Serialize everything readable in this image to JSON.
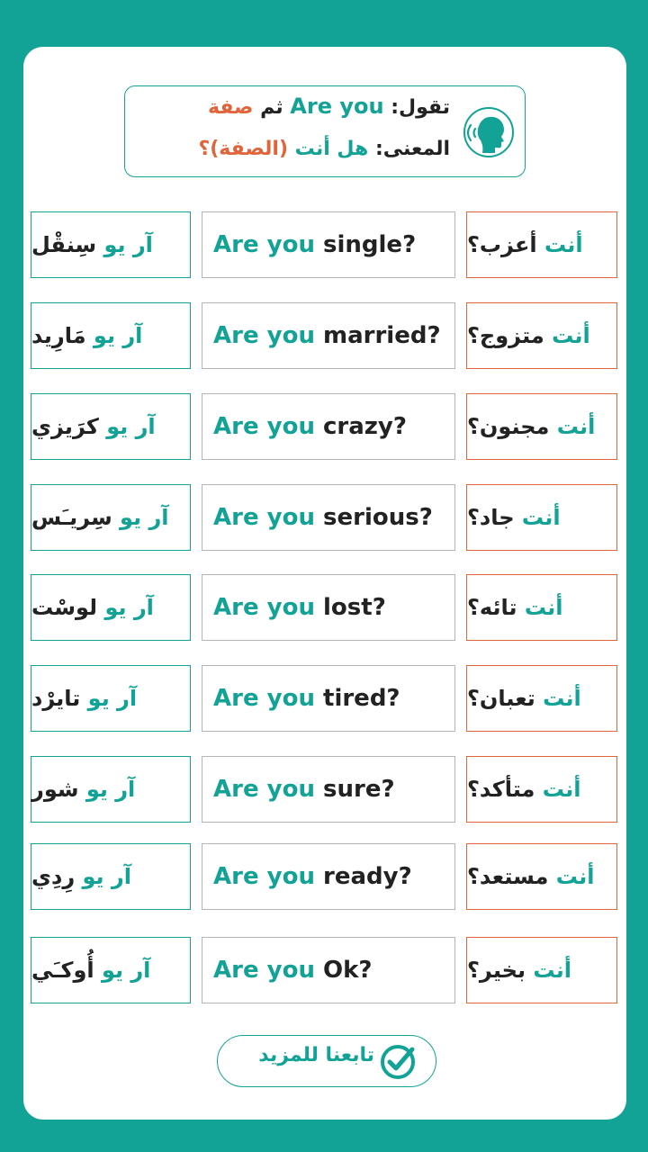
{
  "header": {
    "line1": {
      "prefix": "تقول:",
      "phrase": "Are you",
      "then": "ثم",
      "adjective": "صفة"
    },
    "line2": {
      "prefix": "المعنى:",
      "meaning": "هل أنت",
      "adjective": "(الصفة)؟"
    }
  },
  "rows": [
    {
      "pron_ar": "آر  يو",
      "pron_word": "سِنقْل",
      "en_prefix": "Are you",
      "en_word": "single?",
      "ar_prefix": "أنت",
      "ar_word": "أعزب؟"
    },
    {
      "pron_ar": "آر يو",
      "pron_word": "مَارِيد",
      "en_prefix": "Are you",
      "en_word": "married?",
      "ar_prefix": "أنت",
      "ar_word": "متزوج؟"
    },
    {
      "pron_ar": "آر  يو",
      "pron_word": "كرَيزي",
      "en_prefix": "Are you",
      "en_word": "crazy?",
      "ar_prefix": "أنت",
      "ar_word": "مجنون؟"
    },
    {
      "pron_ar": "آر  يو",
      "pron_word": "سِريـَس",
      "en_prefix": "Are you",
      "en_word": "serious?",
      "ar_prefix": "أنت",
      "ar_word": "جاد؟"
    },
    {
      "pron_ar": "آر  يو",
      "pron_word": "لوسْت",
      "en_prefix": "Are you",
      "en_word": "lost?",
      "ar_prefix": "أنت",
      "ar_word": "تائه؟"
    },
    {
      "pron_ar": "آر  يو",
      "pron_word": "تايرْد",
      "en_prefix": "Are you",
      "en_word": "tired?",
      "ar_prefix": "أنت",
      "ar_word": "تعبان؟"
    },
    {
      "pron_ar": "آر يو",
      "pron_word": "شور",
      "en_prefix": "Are you",
      "en_word": "sure?",
      "ar_prefix": "أنت",
      "ar_word": "متأكد؟"
    },
    {
      "pron_ar": "آر يو",
      "pron_word": "رِدِي",
      "en_prefix": "Are you",
      "en_word": "ready?",
      "ar_prefix": "أنت",
      "ar_word": "مستعد؟"
    },
    {
      "pron_ar": "آر يو",
      "pron_word": "أُوكـَي",
      "en_prefix": "Are you",
      "en_word": "Ok?",
      "ar_prefix": "أنت",
      "ar_word": "بخير؟"
    }
  ],
  "footer": {
    "follow_label": "تابعنا للمزيد"
  },
  "colors": {
    "teal": "#13a396",
    "orange": "#e0653a",
    "text": "#222222"
  },
  "icons": {
    "header": "speaking-head-icon",
    "footer": "check-circle-icon"
  }
}
